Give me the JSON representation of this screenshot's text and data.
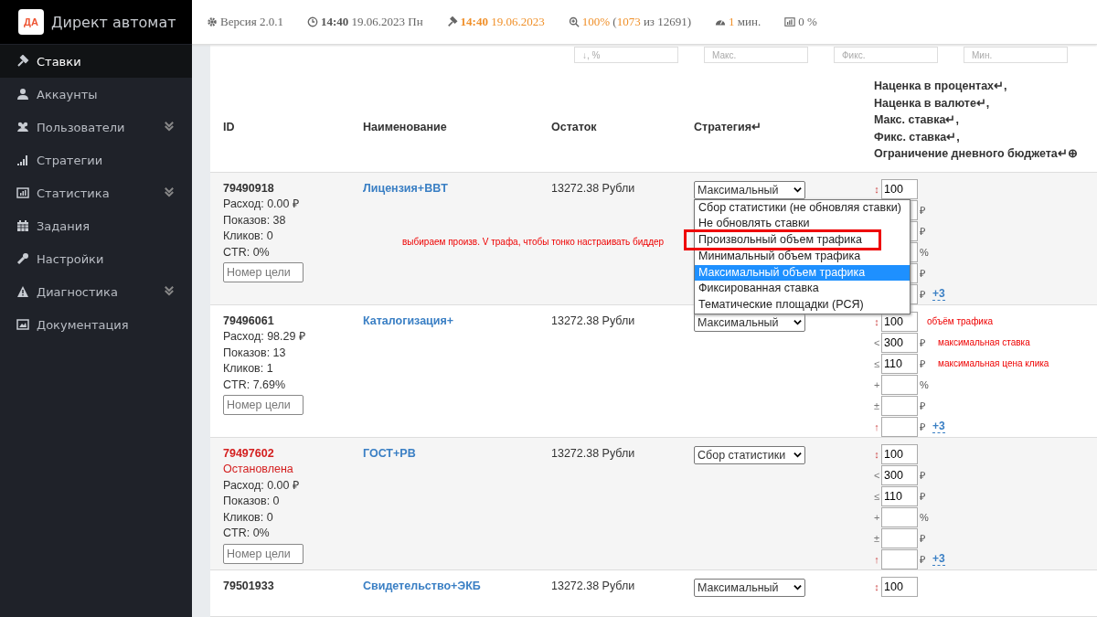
{
  "logo": {
    "mark": "ДА",
    "title": "Директ автомат"
  },
  "header": [
    {
      "parts": [
        {
          "text": "Версия 2.0.1",
          "kind": "plain"
        }
      ]
    },
    {
      "parts": [
        {
          "text": "14:40",
          "kind": "strong"
        },
        {
          "text": " 19.06.2023 Пн",
          "kind": "plain"
        }
      ]
    },
    {
      "parts": [
        {
          "text": "14:40",
          "kind": "alert"
        },
        {
          "text": " 19.06.2023",
          "kind": "accent"
        }
      ]
    },
    {
      "parts": [
        {
          "text": "100%",
          "kind": "accent"
        },
        {
          "text": " (",
          "kind": "plain"
        },
        {
          "text": "1073",
          "kind": "accent"
        },
        {
          "text": " из 12691)",
          "kind": "plain"
        }
      ]
    },
    {
      "parts": [
        {
          "text": "1",
          "kind": "accent"
        },
        {
          "text": " мин.",
          "kind": "plain"
        }
      ]
    },
    {
      "parts": [
        {
          "text": "0 %",
          "kind": "plain"
        }
      ]
    }
  ],
  "sidebar": {
    "items": [
      {
        "label": "Ставки",
        "selected": true,
        "expandable": false
      },
      {
        "label": "Аккаунты",
        "selected": false,
        "expandable": false
      },
      {
        "label": "Пользователи",
        "selected": false,
        "expandable": true
      },
      {
        "label": "Стратегии",
        "selected": false,
        "expandable": false
      },
      {
        "label": "Статистика",
        "selected": false,
        "expandable": true
      },
      {
        "label": "Задания",
        "selected": false,
        "expandable": false
      },
      {
        "label": "Настройки",
        "selected": false,
        "expandable": false
      },
      {
        "label": "Диагностика",
        "selected": false,
        "expandable": true
      },
      {
        "label": "Документация",
        "selected": false,
        "expandable": false
      }
    ]
  },
  "filters": [
    {
      "placeholder": "↓, %"
    },
    {
      "placeholder": "Макс."
    },
    {
      "placeholder": "Фикс."
    },
    {
      "placeholder": "Мин."
    }
  ],
  "table": {
    "columns": [
      "ID",
      "Наименование",
      "Остаток",
      "Стратегия↵"
    ],
    "bid_heading": [
      "Наценка в процентах↵,",
      "Наценка в валюте↵,",
      "Макс. ставка↵,",
      "Фикс. ставка↵,",
      "Ограничение дневного бюджета↵⊕"
    ],
    "rows": [
      {
        "id": "79490918",
        "stopped": false,
        "stats": [
          "Расход: 0.00 ₽",
          "Показов: 38",
          "Кликов: 0",
          "CTR: 0%"
        ],
        "goal_placeholder": "Номер цели",
        "name": "Лицензия+BBT",
        "balance": "13272.38 Рубли",
        "strategy": "Максимальный",
        "note": "выбираем произв. V трафа, чтобы тонко настраивать биддер",
        "dropdown": [
          {
            "label": "Сбор статистики (не обновляя ставки)",
            "selected": false,
            "annotated": false
          },
          {
            "label": "Не обновлять ставки",
            "selected": false,
            "annotated": false
          },
          {
            "label": "Произвольный объем трафика",
            "selected": false,
            "annotated": true
          },
          {
            "label": "Минимальный объем трафика",
            "selected": false,
            "annotated": false
          },
          {
            "label": "Максимальный объем трафика",
            "selected": true,
            "annotated": false
          },
          {
            "label": "Фиксированная ставка",
            "selected": false,
            "annotated": false
          },
          {
            "label": "Тематические площадки (РСЯ)",
            "selected": false,
            "annotated": false
          }
        ],
        "params": [
          {
            "sym": "↕",
            "highlight": true,
            "value": "100"
          },
          {
            "unit": "₽"
          },
          {
            "unit": "₽"
          },
          {
            "unit": "%"
          },
          {
            "unit": "₽"
          },
          {
            "unit": "₽"
          }
        ],
        "more": "+3"
      },
      {
        "id": "79496061",
        "stopped": false,
        "stats": [
          "Расход: 98.29 ₽",
          "Показов: 13",
          "Кликов: 1",
          "CTR: 7.69%"
        ],
        "goal_placeholder": "Номер цели",
        "name": "Каталогизация+",
        "balance": "13272.38 Рубли",
        "strategy": "Максимальный",
        "params": [
          {
            "sym": "↕",
            "highlight": true,
            "value": "100",
            "note": "объём трафика"
          },
          {
            "sym": "<",
            "highlight": false,
            "value": "300",
            "unit": "₽",
            "note": "максимальная ставка"
          },
          {
            "sym": "≤",
            "highlight": false,
            "value": "110",
            "unit": "₽",
            "note": "максимальная цена клика"
          },
          {
            "sym": "+",
            "highlight": false,
            "unit": "%"
          },
          {
            "sym": "±",
            "highlight": false,
            "unit": "₽"
          },
          {
            "sym": "↑",
            "highlight": true,
            "unit": "₽"
          }
        ],
        "more": "+3"
      },
      {
        "id": "79497602",
        "stopped": true,
        "status": "Остановлена",
        "stats": [
          "Расход: 0.00 ₽",
          "Показов: 0",
          "Кликов: 0",
          "CTR: 0%"
        ],
        "goal_placeholder": "Номер цели",
        "name": "ГОСТ+РВ",
        "balance": "13272.38 Рубли",
        "strategy": "Сбор статистики",
        "params": [
          {
            "sym": "↕",
            "highlight": true,
            "value": "100"
          },
          {
            "sym": "<",
            "highlight": false,
            "value": "300",
            "unit": "₽"
          },
          {
            "sym": "≤",
            "highlight": false,
            "value": "110",
            "unit": "₽"
          },
          {
            "sym": "+",
            "highlight": false,
            "unit": "%"
          },
          {
            "sym": "±",
            "highlight": false,
            "unit": "₽"
          },
          {
            "sym": "↑",
            "highlight": true,
            "unit": "₽"
          }
        ],
        "more": "+3"
      },
      {
        "id": "79501933",
        "stopped": false,
        "stats": [],
        "name": "Свидетельство+ЭКБ",
        "balance": "13272.38 Рубли",
        "strategy": "Максимальный",
        "params": [
          {
            "sym": "↕",
            "highlight": true,
            "value": "100"
          }
        ]
      }
    ]
  }
}
